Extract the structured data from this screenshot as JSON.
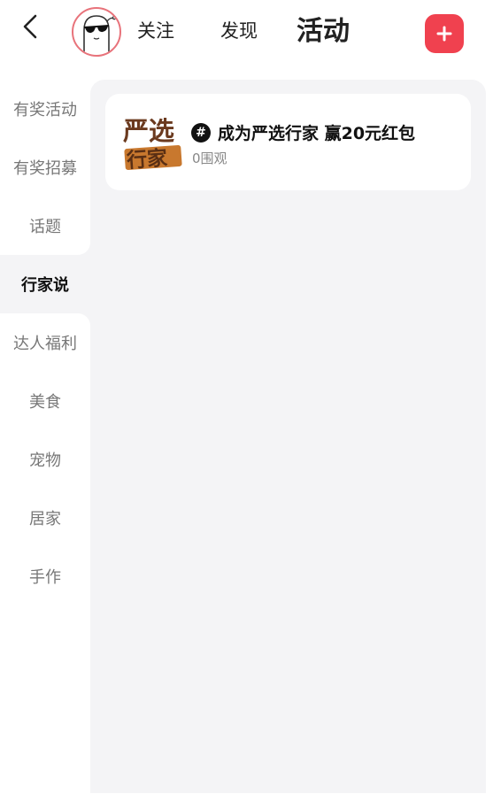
{
  "header": {
    "back_icon": "chevron-left-icon",
    "avatar_icon": "ghost-sunglasses-avatar",
    "tabs": [
      {
        "label": "关注"
      },
      {
        "label": "发现"
      },
      {
        "label": "活动"
      }
    ],
    "active_tab": "活动",
    "add_icon": "plus-icon",
    "add_color": "#f0414f"
  },
  "sidebar": {
    "items": [
      {
        "label": "有奖活动"
      },
      {
        "label": "有奖招募"
      },
      {
        "label": "话题"
      },
      {
        "label": "行家说"
      },
      {
        "label": "达人福利"
      },
      {
        "label": "美食"
      },
      {
        "label": "宠物"
      },
      {
        "label": "居家"
      },
      {
        "label": "手作"
      }
    ],
    "active_item": "行家说"
  },
  "main": {
    "cards": [
      {
        "thumb_text": "严选行家",
        "hash_symbol": "#",
        "title": "成为严选行家 赢20元红包",
        "subtitle": "0围观"
      }
    ]
  },
  "colors": {
    "accent": "#f0414f",
    "content_bg": "#f4f4f6",
    "thumb_brown": "#6b3a1f",
    "thumb_orange": "#c8782e"
  }
}
